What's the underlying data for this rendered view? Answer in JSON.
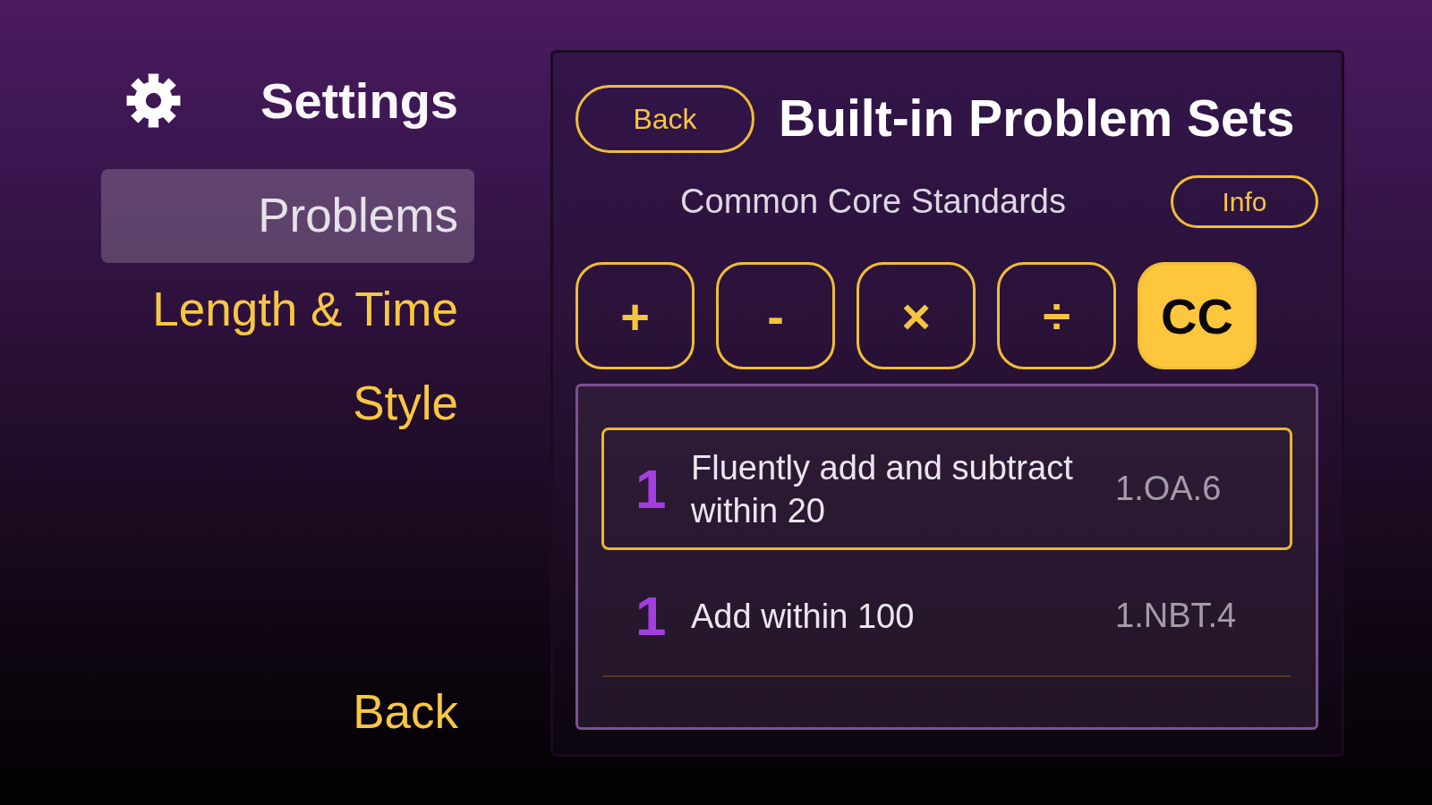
{
  "sidebar": {
    "title": "Settings",
    "items": [
      {
        "label": "Problems",
        "selected": true
      },
      {
        "label": "Length & Time",
        "selected": false
      },
      {
        "label": "Style",
        "selected": false
      }
    ],
    "back": "Back"
  },
  "panel": {
    "back": "Back",
    "title": "Built-in Problem Sets",
    "subtitle": "Common Core Standards",
    "info": "Info",
    "operations": [
      {
        "label": "+",
        "selected": false
      },
      {
        "label": "-",
        "selected": false
      },
      {
        "label": "×",
        "selected": false
      },
      {
        "label": "÷",
        "selected": false
      },
      {
        "label": "CC",
        "selected": true
      }
    ],
    "problem_sets": [
      {
        "grade": "1",
        "title": "Fluently add and subtract within 20",
        "code": "1.OA.6",
        "selected": true
      },
      {
        "grade": "1",
        "title": "Add within 100",
        "code": "1.NBT.4",
        "selected": false
      }
    ]
  }
}
